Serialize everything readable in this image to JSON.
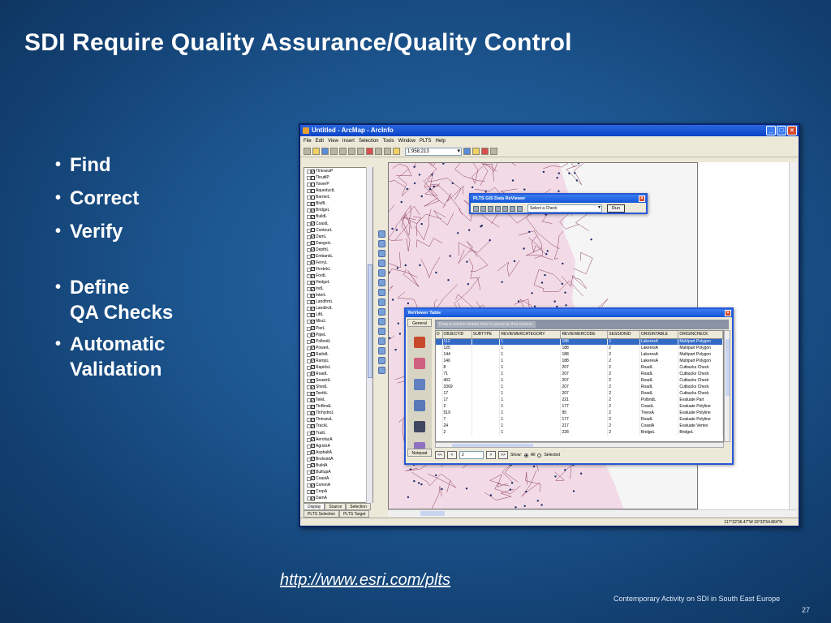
{
  "slide": {
    "title": "SDI Require Quality Assurance/Quality Control",
    "bullets": [
      "Find",
      "Correct",
      "Verify",
      "Define\nQA Checks",
      "Automatic\nValidation"
    ],
    "url": "http://www.esri.com/plts",
    "footer": "Contemporary Activity on SDI in South East Europe",
    "page_number": "27"
  },
  "arcmap": {
    "window_title": "Untitled - ArcMap - ArcInfo",
    "menu": [
      "File",
      "Edit",
      "View",
      "Insert",
      "Selection",
      "Tools",
      "Window",
      "PLTS",
      "Help"
    ],
    "scale": "1:958,213",
    "toc_layers": [
      "TlntransP",
      "TlnutilP",
      "TowerP",
      "AqueductL",
      "BarrierL",
      "BluffL",
      "BridgeL",
      "BuildL",
      "CoastL",
      "ContourL",
      "DamL",
      "DangerL",
      "DepthL",
      "EmbankL",
      "FerryL",
      "FirebrkL",
      "FordL",
      "HedgeL",
      "IndL",
      "InterL",
      "LandfrmL",
      "LandtrvlL",
      "LiftL",
      "MiscL",
      "PierL",
      "PipeL",
      "PolbndL",
      "PowerL",
      "RailrdL",
      "RampL",
      "RapidsL",
      "RoadL",
      "SeastrtL",
      "ShedL",
      "TeethL",
      "TeleL",
      "TlnfbndL",
      "TlnhydroL",
      "TlntransL",
      "TrackL",
      "TrailL",
      "AerofacA",
      "AgristrA",
      "AsphaltA",
      "BndvoidA",
      "BuildA",
      "BuiltupA",
      "CoastA",
      "CommA",
      "CropA",
      "DamA"
    ],
    "toc_checked": [
      true,
      false,
      false,
      false,
      false,
      true,
      true,
      true,
      true,
      false,
      true,
      true,
      true,
      true,
      true,
      true,
      true,
      true,
      true,
      true,
      true,
      true,
      true,
      true,
      true,
      true,
      true,
      true,
      true,
      true,
      true,
      true,
      true,
      true,
      true,
      true,
      true,
      true,
      true,
      true,
      true,
      true,
      true,
      true,
      true,
      true,
      true,
      true,
      true,
      true,
      true
    ],
    "toc_tabs": [
      "Display",
      "Source",
      "Selection",
      "PLTS Selection",
      "PLTS Target"
    ],
    "coordinates": "117°22'36.47\"W  33°32'54.864\"N"
  },
  "reviewer": {
    "title": "PLTS GIS Data ReViewer",
    "select_placeholder": "Select a Check",
    "run_label": "Run"
  },
  "reviewer_table": {
    "title": "ReViewer Table",
    "side_tab_general": "General",
    "side_tab_notepad": "Notepad",
    "group_hint": "Drag a column header here to group by that column.",
    "columns": [
      "D",
      "OBJECTID",
      "SUBTYPE",
      "REVIEWERCATEGORY",
      "REVIEWERCODE",
      "SESSIONID",
      "ORIGINTABLE",
      "ORIGINCHECK"
    ],
    "rows": [
      [
        "",
        "112",
        "",
        "1",
        "188",
        "2",
        "LakeresA",
        "Multipart Polygon"
      ],
      [
        "",
        "125",
        "",
        "1",
        "188",
        "2",
        "LakeresA",
        "Multipart Polygon"
      ],
      [
        "",
        "144",
        "",
        "1",
        "188",
        "2",
        "LakeresA",
        "Multipart Polygon"
      ],
      [
        "",
        "146",
        "",
        "1",
        "188",
        "2",
        "LakeresA",
        "Multipart Polygon"
      ],
      [
        "",
        "8",
        "",
        "1",
        "207",
        "2",
        "RoadL",
        "Cutbacks Check"
      ],
      [
        "",
        "71",
        "",
        "1",
        "207",
        "2",
        "RoadL",
        "Cutbacks Check"
      ],
      [
        "",
        "402",
        "",
        "1",
        "207",
        "2",
        "RoadL",
        "Cutbacks Check"
      ],
      [
        "",
        "3369",
        "",
        "1",
        "207",
        "2",
        "RoadL",
        "Cutbacks Check"
      ],
      [
        "",
        "17",
        "",
        "1",
        "207",
        "2",
        "RoadL",
        "Cutbacks Check"
      ],
      [
        "",
        "17",
        "",
        "1",
        "221",
        "2",
        "PolbndL",
        "Evaluate Part"
      ],
      [
        "",
        "2",
        "",
        "1",
        "177",
        "2",
        "CoastL",
        "Evaluate Polyline"
      ],
      [
        "",
        "519",
        "",
        "1",
        "95",
        "2",
        "TreesA",
        "Evaluate Polyline"
      ],
      [
        "",
        "7",
        "",
        "1",
        "177",
        "2",
        "RoadL",
        "Evaluate Polyline"
      ],
      [
        "",
        "24",
        "",
        "1",
        "217",
        "2",
        "CoastA",
        "Evaluate Vertex"
      ],
      [
        "",
        "2",
        "",
        "1",
        "228",
        "2",
        "BridgeL",
        "BridgeL"
      ]
    ],
    "selected_row": 0,
    "page_value": "2",
    "show_label": "Show:",
    "radio_all": "All",
    "radio_selected": "Selected",
    "nav_first": "<<",
    "nav_prev": "<",
    "nav_next": ">",
    "nav_last": ">>"
  }
}
